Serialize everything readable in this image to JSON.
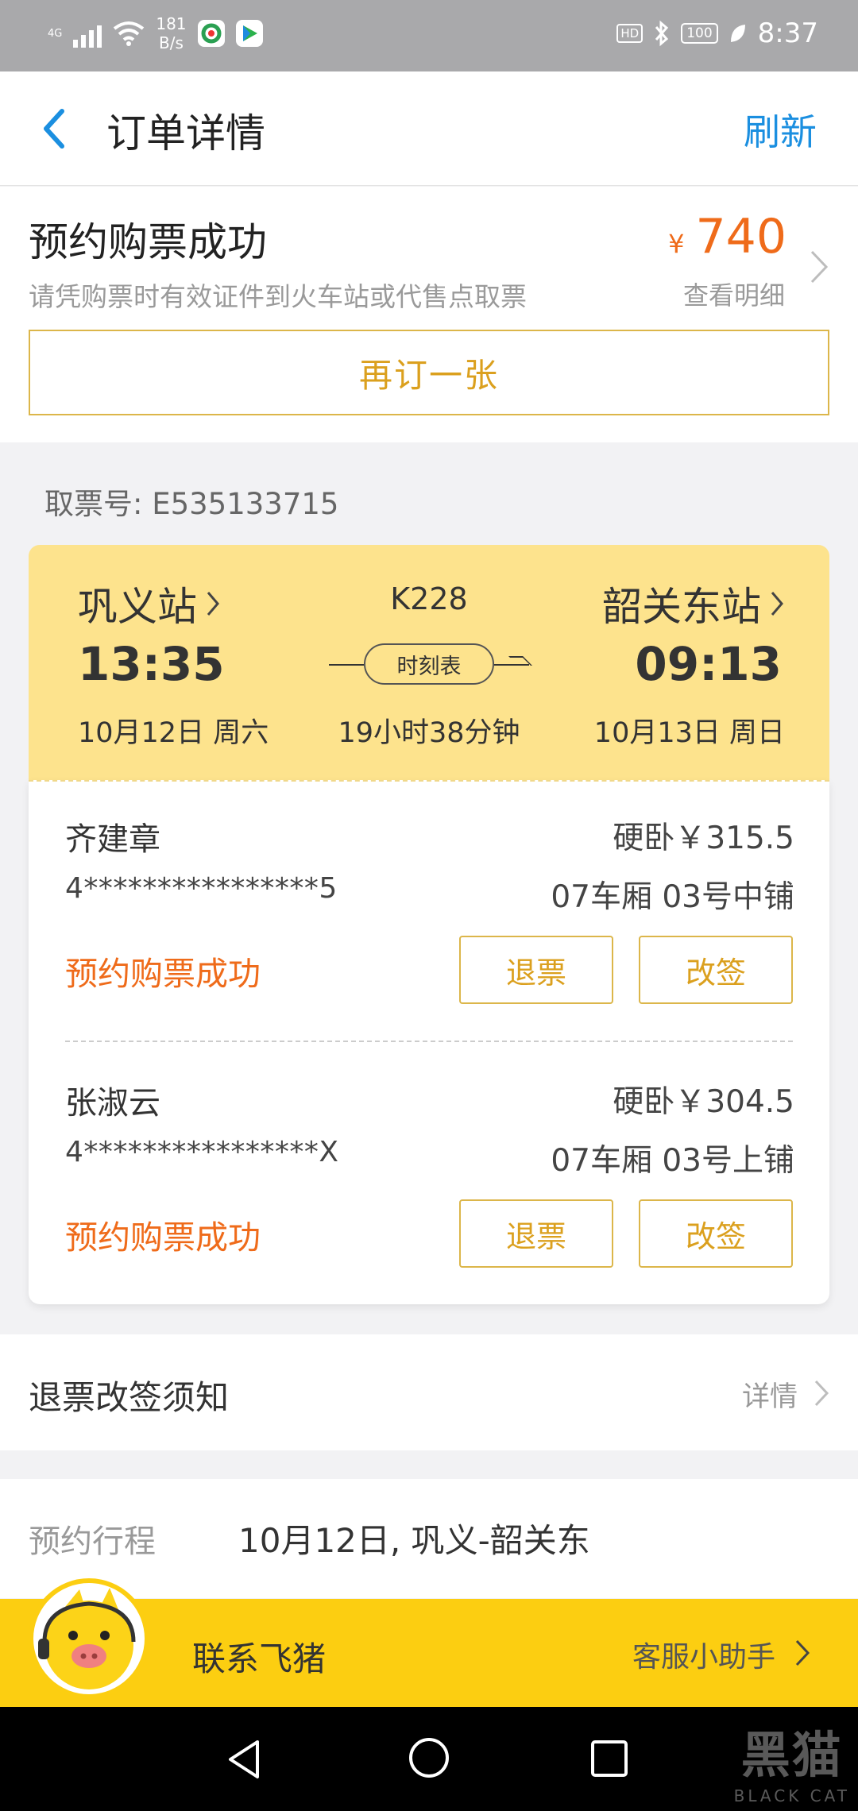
{
  "status_bar": {
    "network": "4G",
    "speed_value": "181",
    "speed_unit": "B/s",
    "hd": "HD",
    "battery": "100",
    "time": "8:37"
  },
  "header": {
    "title": "订单详情",
    "refresh": "刷新"
  },
  "summary": {
    "status": "预约购票成功",
    "hint": "请凭购票时有效证件到火车站或代售点取票",
    "currency": "¥",
    "price": "740",
    "detail_link": "查看明细",
    "rebook": "再订一张"
  },
  "ticket": {
    "number_label": "取票号: E535133715"
  },
  "train": {
    "from_station": "巩义站",
    "to_station": "韶关东站",
    "train_no": "K228",
    "dep_time": "13:35",
    "arr_time": "09:13",
    "schedule": "时刻表",
    "dep_date": "10月12日 周六",
    "arr_date": "10月13日 周日",
    "duration": "19小时38分钟"
  },
  "passengers": [
    {
      "name": "齐建章",
      "price": "硬卧￥315.5",
      "id": "4****************5",
      "seat": "07车厢 03号中铺",
      "status": "预约购票成功",
      "refund": "退票",
      "change": "改签"
    },
    {
      "name": "张淑云",
      "price": "硬卧￥304.5",
      "id": "4****************X",
      "seat": "07车厢 03号上铺",
      "status": "预约购票成功",
      "refund": "退票",
      "change": "改签"
    }
  ],
  "notice": {
    "title": "退票改签须知",
    "detail": "详情"
  },
  "itinerary": {
    "label": "预约行程",
    "value": "10月12日, 巩义-韶关东"
  },
  "contact": {
    "label": "联系飞猪",
    "assistant": "客服小助手"
  },
  "watermark": {
    "cn": "黑猫",
    "en": "BLACK CAT"
  },
  "colors": {
    "accent_blue": "#1b8fe0",
    "price_orange": "#ef6b1a",
    "gold": "#dba01e",
    "card_yellow": "#fde38d",
    "bar_yellow": "#fcce11"
  }
}
